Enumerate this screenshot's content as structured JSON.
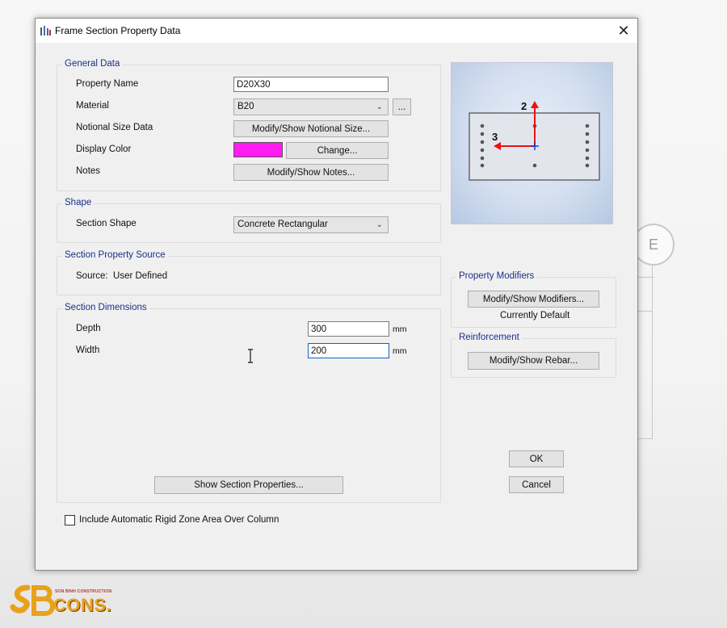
{
  "dialog": {
    "title": "Frame Section Property Data",
    "close_label": "✕"
  },
  "general_data": {
    "title": "General Data",
    "property_name_label": "Property Name",
    "property_name_value": "D20X30",
    "material_label": "Material",
    "material_value": "B20",
    "material_ellipsis": "...",
    "notional_label": "Notional Size Data",
    "notional_button": "Modify/Show Notional Size...",
    "display_color_label": "Display Color",
    "display_color_value": "#ff1cf0",
    "change_button": "Change...",
    "notes_label": "Notes",
    "notes_button": "Modify/Show Notes..."
  },
  "shape": {
    "title": "Shape",
    "section_shape_label": "Section Shape",
    "section_shape_value": "Concrete Rectangular"
  },
  "source": {
    "title": "Section Property Source",
    "source_text": "Source:  User Defined"
  },
  "dimensions": {
    "title": "Section Dimensions",
    "depth_label": "Depth",
    "depth_value": "300",
    "depth_unit": "mm",
    "width_label": "Width",
    "width_value": "200",
    "width_unit": "mm",
    "show_properties_button": "Show Section Properties..."
  },
  "preview": {
    "axis_2": "2",
    "axis_3": "3"
  },
  "modifiers": {
    "title": "Property Modifiers",
    "button": "Modify/Show Modifiers...",
    "status": "Currently Default"
  },
  "reinforcement": {
    "title": "Reinforcement",
    "button": "Modify/Show Rebar..."
  },
  "actions": {
    "ok": "OK",
    "cancel": "Cancel"
  },
  "rigid_zone": {
    "label": "Include Automatic Rigid Zone Area Over Column",
    "checked": false
  },
  "background": {
    "grid_bubble": "E"
  },
  "watermark": {
    "small_text": "SON BINH CONSTRUCTION",
    "brand": "CONS."
  }
}
